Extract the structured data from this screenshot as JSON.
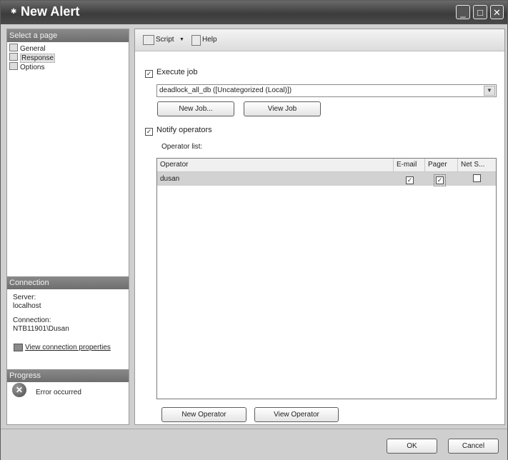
{
  "window": {
    "title": "New Alert",
    "controls": {
      "minimize": "_",
      "maximize": "□",
      "close": "✕"
    }
  },
  "left_panel": {
    "select_page_header": "Select a page",
    "pages": [
      {
        "label": "General",
        "icon": "page-icon"
      },
      {
        "label": "Response",
        "icon": "page-icon",
        "selected": true
      },
      {
        "label": "Options",
        "icon": "page-icon"
      }
    ],
    "connection": {
      "header": "Connection",
      "server_label": "Server:",
      "server_value": "localhost",
      "connection_label": "Connection:",
      "connection_value": "NTB11901\\Dusan",
      "properties_link": "View connection properties"
    },
    "progress": {
      "header": "Progress",
      "status": "Error occurred"
    }
  },
  "toolbar": {
    "script_label": "Script",
    "script_dropdown": "▼",
    "help_label": "Help"
  },
  "response": {
    "execute_job_label": "Execute job",
    "execute_job_checked": true,
    "job_selected": "deadlock_all_db ([Uncategorized (Local)])",
    "new_job_button": "New Job...",
    "view_job_button": "View Job",
    "notify_operators_label": "Notify operators",
    "notify_operators_checked": true,
    "operator_list_label": "Operator list:",
    "grid": {
      "columns": [
        "Operator",
        "E-mail",
        "Pager",
        "Net S..."
      ],
      "rows": [
        {
          "operator": "dusan",
          "email": true,
          "pager": true,
          "net_send": false
        }
      ]
    },
    "new_operator_button": "New Operator",
    "view_operator_button": "View Operator"
  },
  "footer": {
    "ok_button": "OK",
    "cancel_button": "Cancel"
  }
}
